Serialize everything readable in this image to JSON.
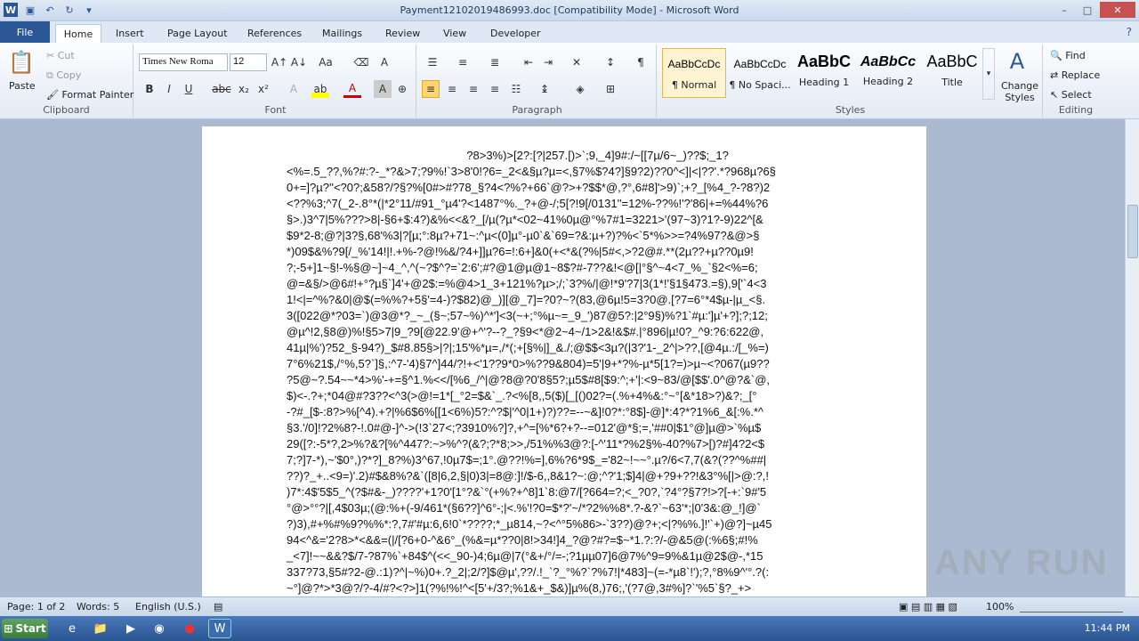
{
  "window": {
    "title": "Payment12102019486993.doc [Compatibility Mode] - Microsoft Word",
    "minimize_glyph": "–",
    "maximize_glyph": "□",
    "close_glyph": "✕"
  },
  "quick_access": {
    "icons": [
      "word-app-icon",
      "save-icon",
      "undo-icon",
      "redo-icon",
      "customize-icon"
    ]
  },
  "tabs": [
    "File",
    "Home",
    "Insert",
    "Page Layout",
    "References",
    "Mailings",
    "Review",
    "View",
    "Developer"
  ],
  "active_tab": "Home",
  "clipboard": {
    "paste": "Paste",
    "cut": "Cut",
    "copy": "Copy",
    "format_painter": "Format Painter",
    "label": "Clipboard"
  },
  "font": {
    "name": "Times New Roma",
    "size": "12",
    "label": "Font",
    "bold": "B",
    "italic": "I",
    "underline": "U",
    "strike": "abc",
    "sub": "x₂",
    "sup": "x²"
  },
  "paragraph": {
    "label": "Paragraph",
    "pilcrow": "¶"
  },
  "styles": {
    "label": "Styles",
    "items": [
      {
        "preview": "AaBbCcDc",
        "name": "¶ Normal"
      },
      {
        "preview": "AaBbCcDc",
        "name": "¶ No Spaci..."
      },
      {
        "preview": "AaBbC",
        "name": "Heading 1"
      },
      {
        "preview": "AaBbCc",
        "name": "Heading 2"
      },
      {
        "preview": "AaBbC",
        "name": "Title"
      }
    ],
    "change_styles": "Change Styles"
  },
  "editing": {
    "label": "Editing",
    "find": "Find",
    "replace": "Replace",
    "select": "Select"
  },
  "document": {
    "text": "                                                        ?8>3%)>[2?:[?|257.[)>`;9,_4]9#:/~[[7µ/6~_)??$;_1?\n<%=.5_??,%?#:?-_*?&>7;?9%!`3>8'0!?6=_2<&§µ?µ=<,§7%$?4?]§9?2)??0^<]|<|??'.*?968µ?6§\n0+=]?µ?''<?0?;&58?/?§?%[0#>#?78_§?4<?%?+66`@?>+?$$*@,?°,6#8]'>9)`;+?_[%4_?-?8?)2\n<??%3;^7(_2-.8°*(|*2°11/#91_°µ4'?<1487°%._?+@-/;5[?!9[/0131''=12%-??%!'?'86|+=%44%?6\n§>.)3^7|5%???>8|-§6+$:4?)&%<<&?_[/µ(?µ*<02~41%0µ@°%7#1=3221>'(97~3)?1?-9)22^[&\n$9*2-8;@?|3?§,68'%3|?[µ;°:8µ?+71~:^µ<(0]µ°-µ0`&`69=?&:µ+?)?%<`5*%>>=?4%97?&@>§\n*)09$&%?9[/_%'14!|!.+%-?@!%&/?4+]]µ?6=!:6+]&0(+<*&(?%|5#<,>?2@#.**(2µ??+µ??0µ9!\n?;-5+]1~§!-%§@~]~4_^,^(~?$^?=`2:6';#?@1@µ@1~8$?#-7??&!<@[|°§^~4<7_%_`§2<%=6;\n@=&§/>@6#!+°?µ§`]4'+@2$:=%@4>1_3+121%?µ>;/;`3?%/|@!*9'?7|3(1*!'§1§473.=§),9['`4<3\n1!<|=^%?&0|@$(=%%?+5§'=4-)?$82)@_)][@_7]=?0?~?(83,@6µ!5=3?0@.[?7=6°*4$µ-|µ_<§.\n3([022@*?03=`)@3@*?_~_(§~;57~%)^*']<3(~+;°%µ~=_9_')87@5?:|2°9§)%?1`#µ:']µ'+?];?;12;\n@µ^!2,§8@)%!§5>7|9_?9[@22.9'@+^'?--?_?§9<*@2~4~/1>2&!&$#.|°896|µ!0?_^9:?6:622@,\n41µ|%')?52_§-94?)_$#8.85§>|?|;15'%*µ=,/*(;+[§%|]_&./;@$$<3µ?(|3?'1-_2^|>??,[@4µ.:/[_%=)\n7°6%21$,/°%,5?`]§,:^7-'4)§7^]44/?!+<'1??9*0>%??9&804)=5'|9+*?%-µ*5[1?=)>µ~<?067(µ9??\n?5@~?.54~~*4>%'-+=§^1.%<</[%6_/^|@?8@?0'8§5?;µ5$#8[$9:^;+'|:<9~83/@[$$'.0^@?&`@,\n$)<-.?+;*04@#?3??<^3(>@!=1*[_°2=$&`_.?<%[8,,5($)[_[()02?=(.%+4%&:°~°[&*18>?)&?;_[°\n-?#_[$-:8?>%[^4).+?|%6$6%[[1<6%)5?:^?$|'^0|1+)?)??=--~&]!0?*:°8$]-@]*:4?*?1%6_&[:%.*^\n§3.'/0]!?2%8?-!.0#@-]^->(!3`27<;?3910%?]?,+^=[%*6?+?--=012'@*§;=,'##0|$1°@]µ@>`%µ$\n29([?:-5*?,2>%?&?[%^447?:~>%^?(&?;?*8;>>,/51%%3@?:[-^'11*?%2§%-40?%7>[)?#]4?2<$\n7;?]7-*),~'$0°,)?*?]_8?%)3^67,!0µ7$=;1°.@??!%=],6%?6*9$_='82~!~~°.µ?/6<7,7(&?(??^%##|\n??)?_+..<9=)'.2)#$&8%?&`([8|6,2,§|0)3|=8@:]!/$-6,,8&1?~:@;^?'1;$]4|@+?9+??!&3°%[|>@:?,!\n)7*:4$'5$5_^(?$#&-_)????'+1?0'[1°?&`°(+%?+^8]1`8:@7/[?664=?;<_?0?,`?4°?§7?!>?[-+:`9#'5\n°@>°°?|[,4$03µ;(@:%+(-9/461*(§6??]^6°-;|<.%'!?0=$*?'~/*?2%%8*.?-&?`~63'*;|0'3&:@_!]@`\n?)3),#+%#%9?%%*:?,7#'#µ:6,6!0`*????;*_µ814,~?<^°5%86>-`3??)@?+;<|?%%.]!'`+)@?]~µ45\n94<^&='2?8>*<&&=(|/[?6+0-^&6°_(%&=µ*??0|8!>34!]4_?@?#?=$~*1.?:?/-@&5@(:%6§;#!%\n_<7]!~~&&?$/7-?87%`+84$^(<<_90-)4;6µ@|7(°&+/°/=-;?1µµ07]6@7%^9=9%&1µ@2$@-,*15\n337?73,§5#?2-@.:1)?^|~%)0+.?_2|;2/?]$@µ',??/.!_`?_°%?`?%7!|*483]~(=-*µ8`!');?,°8%9^'°.?(:\n~°]@?*>*3@?/?-4/#?<?>]1(?%!%!^<[5'+/3?;%1&+_$&)]µ%(8,)76;,'(?7@,3#%]?`'%5`§?_+>"
  },
  "status": {
    "page": "Page: 1 of 2",
    "words": "Words: 5",
    "language": "English (U.S.)",
    "zoom": "100%"
  },
  "taskbar": {
    "start": "Start",
    "clock": "11:44 PM"
  },
  "watermark": "ANY RUN",
  "colors": {
    "accent": "#2b5797",
    "highlight_style": "#e6b54d"
  }
}
